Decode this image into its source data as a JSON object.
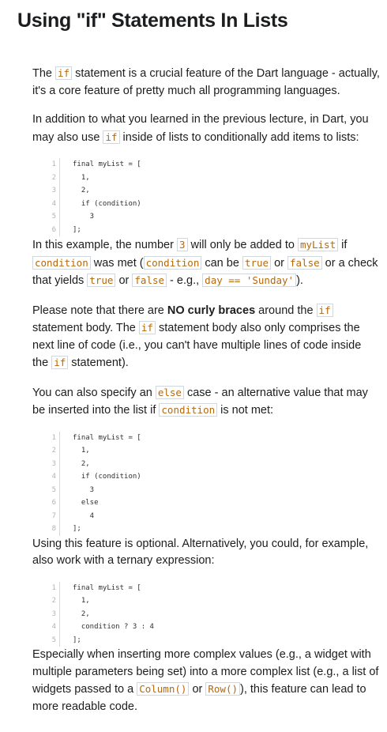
{
  "title": "Using \"if\" Statements In Lists",
  "paragraphs": {
    "p1": {
      "c1": "if",
      "t1": "The ",
      "t2": " statement is a crucial feature of the Dart language - actually, it's a core feature of pretty much all programming languages."
    },
    "p2": {
      "t1": "In addition to what you learned in the previous lecture, in Dart, you may also use ",
      "c1": "if",
      "t2": " inside of lists to conditionally add items to lists:"
    },
    "p3": {
      "t1": "In this example, the number ",
      "c1": "3",
      "t2": " will only be added to ",
      "c2": "myList",
      "t3": " if ",
      "c3": "condition",
      "t4": " was met (",
      "c4": "condition",
      "t5": " can be ",
      "c5": "true",
      "t6": " or ",
      "c6": "false",
      "t7": " or a check that yields ",
      "c7": "true",
      "t8": " or ",
      "c8": "false",
      "t9": " - e.g., ",
      "c9": "day == 'Sunday'",
      "t10": ")."
    },
    "p4": {
      "t1": "Please note that there are ",
      "b1": "NO curly braces",
      "t2": " around the ",
      "c1": "if",
      "t3": " statement body. The ",
      "c2": "if",
      "t4": " statement body also only comprises the next line of code (i.e., you can't have multiple lines of code inside the ",
      "c3": "if",
      "t5": " statement)."
    },
    "p5": {
      "t1": "You can also specify an ",
      "c1": "else",
      "t2": " case - an alternative value that may be inserted into the list if ",
      "c2": "condition",
      "t3": " is not met:"
    },
    "p6": {
      "t1": "Using this feature is optional. Alternatively, you could, for example, also work with a ternary expression:"
    },
    "p7": {
      "t1": "Especially when inserting more complex values (e.g., a widget with multiple parameters being set) into a more complex list (e.g., a list of widgets passed to a ",
      "c1": "Column()",
      "t2": " or ",
      "c2": "Row()",
      "t3": "), this feature can lead to more readable code."
    }
  },
  "code1": {
    "l1": {
      "n": "1",
      "c": "final myList = ["
    },
    "l2": {
      "n": "2",
      "c": "  1,"
    },
    "l3": {
      "n": "3",
      "c": "  2,"
    },
    "l4": {
      "n": "4",
      "c": "  if (condition)"
    },
    "l5": {
      "n": "5",
      "c": "    3"
    },
    "l6": {
      "n": "6",
      "c": "];"
    }
  },
  "code2": {
    "l1": {
      "n": "1",
      "c": "final myList = ["
    },
    "l2": {
      "n": "2",
      "c": "  1,"
    },
    "l3": {
      "n": "3",
      "c": "  2,"
    },
    "l4": {
      "n": "4",
      "c": "  if (condition)"
    },
    "l5": {
      "n": "5",
      "c": "    3"
    },
    "l6": {
      "n": "6",
      "c": "  else"
    },
    "l7": {
      "n": "7",
      "c": "    4"
    },
    "l8": {
      "n": "8",
      "c": "];"
    }
  },
  "code3": {
    "l1": {
      "n": "1",
      "c": "final myList = ["
    },
    "l2": {
      "n": "2",
      "c": "  1,"
    },
    "l3": {
      "n": "3",
      "c": "  2,"
    },
    "l4": {
      "n": "4",
      "c": "  condition ? 3 : 4"
    },
    "l5": {
      "n": "5",
      "c": "];"
    }
  },
  "colors": {
    "code_text": "#b4690e",
    "code_border": "#d1d7dc",
    "text": "#1c1d1f"
  }
}
